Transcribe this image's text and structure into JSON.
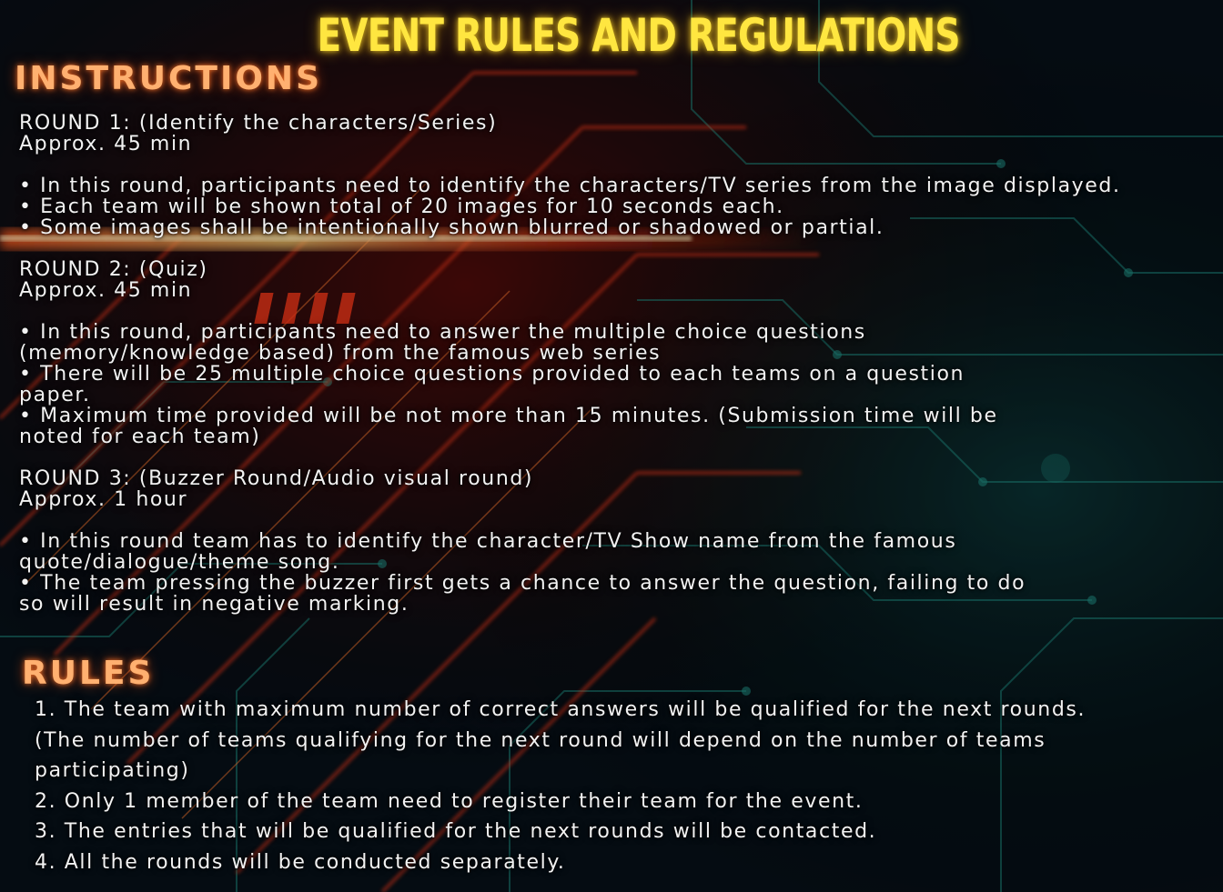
{
  "page": {
    "title": "EVENT RULES AND REGULATIONS",
    "colors": {
      "title": "#ffe640",
      "heading": "#ffb070",
      "body_text": "#f2f2f2",
      "background": "#071018",
      "circuit_red": "#ff3a1a",
      "circuit_teal": "#1f8a80"
    }
  },
  "instructions": {
    "heading": "INSTRUCTIONS",
    "round1": {
      "title": "ROUND 1: (Identify the characters/Series)",
      "duration": "Approx. 45 min",
      "bullets": [
        "• In this round, participants need to identify the characters/TV series from the image displayed.",
        "• Each team will be shown total of 20 images for 10 seconds each.",
        "• Some images shall be intentionally shown blurred or shadowed or partial."
      ]
    },
    "round2": {
      "title": "ROUND 2: (Quiz)",
      "duration": "Approx. 45 min",
      "lines": [
        "• In this round, participants need to answer the multiple choice questions",
        "(memory/knowledge based) from the famous web series",
        "• There will be 25 multiple choice questions provided to each teams on a question",
        "paper.",
        "• Maximum time provided will be not more than 15 minutes. (Submission time will be",
        "noted for each team)"
      ]
    },
    "round3": {
      "title": "ROUND 3: (Buzzer Round/Audio visual round)",
      "duration": "Approx. 1 hour",
      "lines": [
        "• In this round team has to identify the character/TV Show name from the famous",
        "quote/dialogue/theme song.",
        "• The team pressing the buzzer first gets a chance to answer the question, failing to do",
        "so will result in negative marking."
      ]
    }
  },
  "rules": {
    "heading": "RULES",
    "lines": [
      "1. The team with maximum number of correct answers will be qualified for the next rounds.",
      "(The number of teams qualifying for the next round will depend on the number of teams",
      "participating)",
      "2. Only 1 member of the team need to register their team for the event.",
      "3. The entries that will be qualified for the next rounds will be contacted.",
      "4. All the rounds will be conducted separately."
    ]
  }
}
